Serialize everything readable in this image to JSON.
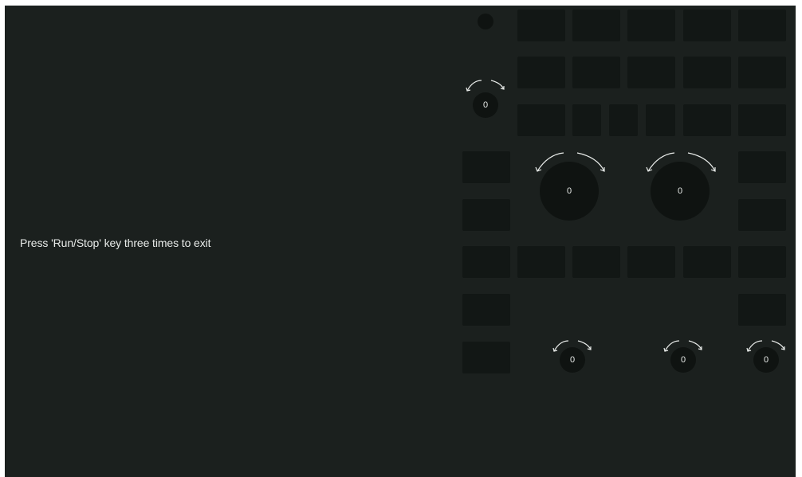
{
  "screen": {
    "hint_text": "Press 'Run/Stop' key three times to exit"
  },
  "controls": {
    "status_led": {
      "icon": "indicator-dot"
    },
    "knobs": [
      {
        "name": "small-knob-top",
        "value": "0"
      },
      {
        "name": "large-knob-left",
        "value": "0"
      },
      {
        "name": "large-knob-right",
        "value": "0"
      },
      {
        "name": "small-knob-bottom-1",
        "value": "0"
      },
      {
        "name": "small-knob-bottom-2",
        "value": "0"
      },
      {
        "name": "small-knob-bottom-3",
        "value": "0"
      }
    ]
  },
  "colors": {
    "screen_background": "#1b201e",
    "key_fill": "#121715",
    "knob_fill": "#0f1311",
    "text": "#e8ebe9"
  }
}
